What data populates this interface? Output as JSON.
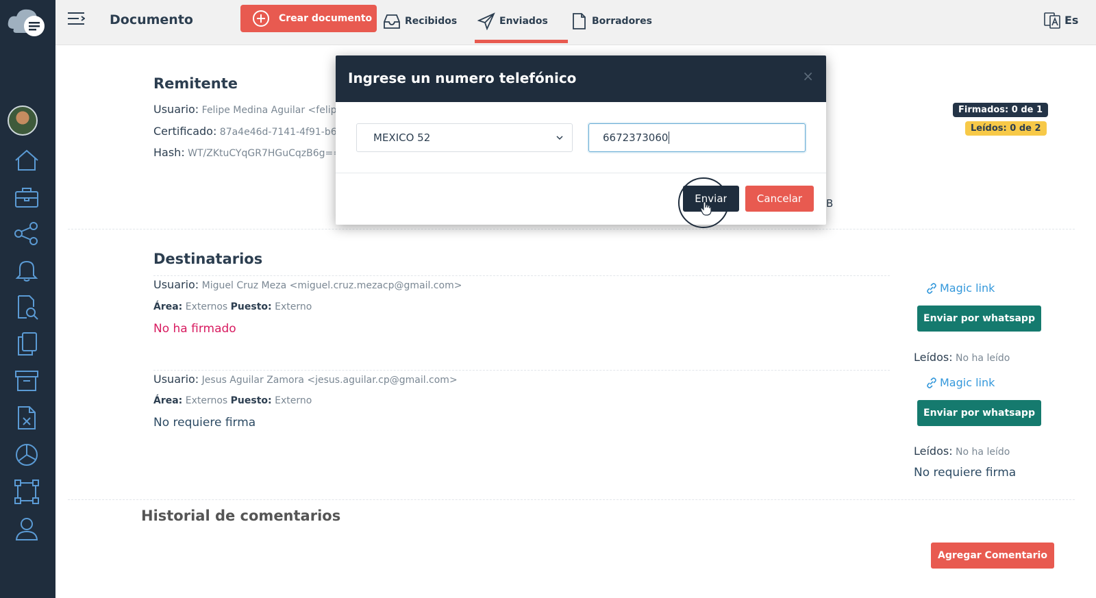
{
  "topbar": {
    "page_title": "Documento",
    "create_label": "Crear documento",
    "tabs": [
      {
        "label": "Recibidos",
        "icon": "inbox-icon"
      },
      {
        "label": "Enviados",
        "icon": "send-icon"
      },
      {
        "label": "Borradores",
        "icon": "document-icon"
      }
    ],
    "active_tab": "Enviados",
    "language": "Es"
  },
  "sidebar": {
    "icons": [
      "home-icon",
      "briefcase-icon",
      "share-icon",
      "bell-icon",
      "document-search-icon",
      "copy-icon",
      "archive-icon",
      "excel-file-icon",
      "pie-chart-icon",
      "frame-icon",
      "user-icon"
    ]
  },
  "remitente": {
    "title": "Remitente",
    "usuario_label": "Usuario:",
    "usuario_value": "Felipe Medina Aguilar <felipe",
    "certificado_label": "Certificado:",
    "certificado_value": "87a4e46d-7141-4f91-b6e",
    "hash_label": "Hash:",
    "hash_value": "WT/ZKtuCYqGR7HGuCqzB6g=="
  },
  "badges": {
    "firmados": "Firmados: 0 de 1",
    "leidos": "Leídos: 0 de 2"
  },
  "destinatarios": {
    "title": "Destinatarios",
    "items": [
      {
        "usuario_label": "Usuario:",
        "usuario_value": "Miguel Cruz Meza <miguel.cruz.mezacp@gmail.com>",
        "area_label": "Área:",
        "area_value": "Externos",
        "puesto_label": "Puesto:",
        "puesto_value": "Externo",
        "status": "No ha firmado",
        "magic_link": "Magic link",
        "whatsapp": "Enviar por whatsapp",
        "leidos_label": "Leídos:",
        "leidos_value": "No ha leído"
      },
      {
        "usuario_label": "Usuario:",
        "usuario_value": "Jesus Aguilar Zamora <jesus.aguilar.cp@gmail.com>",
        "area_label": "Área:",
        "area_value": "Externos",
        "puesto_label": "Puesto:",
        "puesto_value": "Externo",
        "status": "No requiere firma",
        "magic_link": "Magic link",
        "whatsapp": "Enviar por whatsapp",
        "leidos_label": "Leídos:",
        "leidos_value": "No ha leído",
        "right_status": "No requiere firma"
      }
    ]
  },
  "history": {
    "title": "Historial de comentarios",
    "add_comment": "Agregar Comentario"
  },
  "stray_text": "B",
  "modal": {
    "title": "Ingrese un numero telefónico",
    "close": "×",
    "country": "MEXICO 52",
    "phone": "6672373060",
    "send": "Enviar",
    "cancel": "Cancelar"
  },
  "colors": {
    "sidebar": "#1f2d3d",
    "accent": "#e85a50",
    "whatsapp": "#157a6e",
    "link": "#3498db",
    "unsigned": "#d81b60"
  }
}
